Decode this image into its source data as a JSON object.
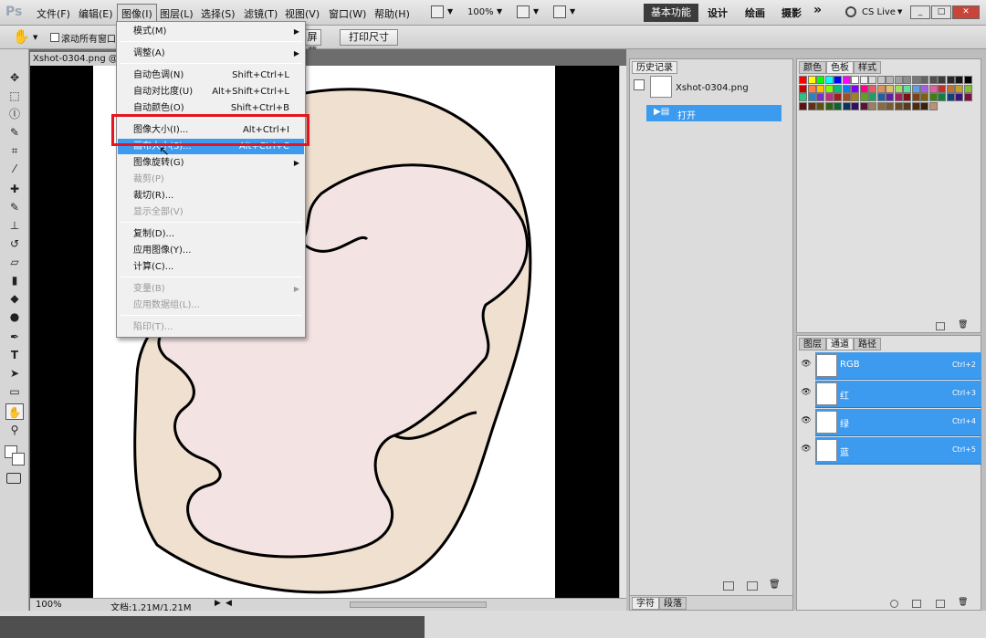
{
  "app": {
    "logo": "Ps"
  },
  "menubar": {
    "items": [
      "文件(F)",
      "编辑(E)",
      "图像(I)",
      "图层(L)",
      "选择(S)",
      "滤镜(T)",
      "视图(V)",
      "窗口(W)",
      "帮助(H)"
    ],
    "zoom": "100%",
    "workspaces": [
      "基本功能",
      "设计",
      "绘画",
      "摄影"
    ],
    "more": "»",
    "cslive": "CS Live"
  },
  "optionsbar": {
    "scroll_all": "滚动所有窗口",
    "fill_screen": "屏幕",
    "print_size": "打印尺寸"
  },
  "document": {
    "tab": "Xshot-0304.png @",
    "zoom": "100%",
    "docinfo": "文档:1.21M/1.21M"
  },
  "image_menu": {
    "items": [
      {
        "label": "模式(M)",
        "submenu": true
      },
      {
        "label": "调整(A)",
        "submenu": true
      },
      {
        "label": "自动色调(N)",
        "shortcut": "Shift+Ctrl+L"
      },
      {
        "label": "自动对比度(U)",
        "shortcut": "Alt+Shift+Ctrl+L"
      },
      {
        "label": "自动颜色(O)",
        "shortcut": "Shift+Ctrl+B"
      },
      {
        "label": "图像大小(I)...",
        "shortcut": "Alt+Ctrl+I"
      },
      {
        "label": "画布大小(S)...",
        "shortcut": "Alt+Ctrl+C"
      },
      {
        "label": "图像旋转(G)",
        "submenu": true
      },
      {
        "label": "裁剪(P)",
        "disabled": true
      },
      {
        "label": "裁切(R)..."
      },
      {
        "label": "显示全部(V)",
        "disabled": true
      },
      {
        "label": "复制(D)..."
      },
      {
        "label": "应用图像(Y)..."
      },
      {
        "label": "计算(C)..."
      },
      {
        "label": "变量(B)",
        "disabled": true,
        "submenu": true
      },
      {
        "label": "应用数据组(L)...",
        "disabled": true
      },
      {
        "label": "陷印(T)...",
        "disabled": true
      }
    ]
  },
  "history": {
    "tab": "历史记录",
    "snapshot": "Xshot-0304.png",
    "step": "打开"
  },
  "bottom_tabs": {
    "char": "字符",
    "para": "段落"
  },
  "swatches": {
    "tabs": [
      "颜色",
      "色板",
      "样式"
    ],
    "colors": [
      "#ff0000",
      "#ffff00",
      "#00ff00",
      "#00ffff",
      "#0000ff",
      "#ff00ff",
      "#ffffff",
      "#f0f0f0",
      "#dcdcdc",
      "#c8c8c8",
      "#b4b4b4",
      "#a0a0a0",
      "#8c8c8c",
      "#787878",
      "#646464",
      "#505050",
      "#3c3c3c",
      "#282828",
      "#141414",
      "#000000",
      "#c80000",
      "#ff8040",
      "#ffc000",
      "#80ff00",
      "#00c080",
      "#0080ff",
      "#8000ff",
      "#ff0080",
      "#e06060",
      "#e09060",
      "#e0c060",
      "#a0e060",
      "#60e0a0",
      "#60a0e0",
      "#a060e0",
      "#e060a0",
      "#c03030",
      "#c07030",
      "#c0a030",
      "#80c030",
      "#30c080",
      "#3080c0",
      "#8030c0",
      "#c03080",
      "#a02020",
      "#a05020",
      "#a08020",
      "#60a020",
      "#20a060",
      "#2060a0",
      "#6020a0",
      "#a02060",
      "#801010",
      "#804010",
      "#806010",
      "#408010",
      "#108040",
      "#104080",
      "#401080",
      "#801040",
      "#601010",
      "#603010",
      "#605010",
      "#306010",
      "#106030",
      "#103060",
      "#301060",
      "#601030",
      "#9b8060",
      "#8a6a40",
      "#7a5a30",
      "#6a4a20",
      "#5a3a18",
      "#4a2a10",
      "#3a2008",
      "#c09070"
    ],
    "shortcuts": [
      "Ctrl+2",
      "Ctrl+3",
      "Ctrl+4",
      "Ctrl+5"
    ]
  },
  "channels": {
    "tabs": [
      "图层",
      "通道",
      "路径"
    ],
    "rows": [
      {
        "name": "RGB",
        "shortcut": "Ctrl+2"
      },
      {
        "name": "红",
        "shortcut": "Ctrl+3"
      },
      {
        "name": "绿",
        "shortcut": "Ctrl+4"
      },
      {
        "name": "蓝",
        "shortcut": "Ctrl+5"
      }
    ]
  }
}
